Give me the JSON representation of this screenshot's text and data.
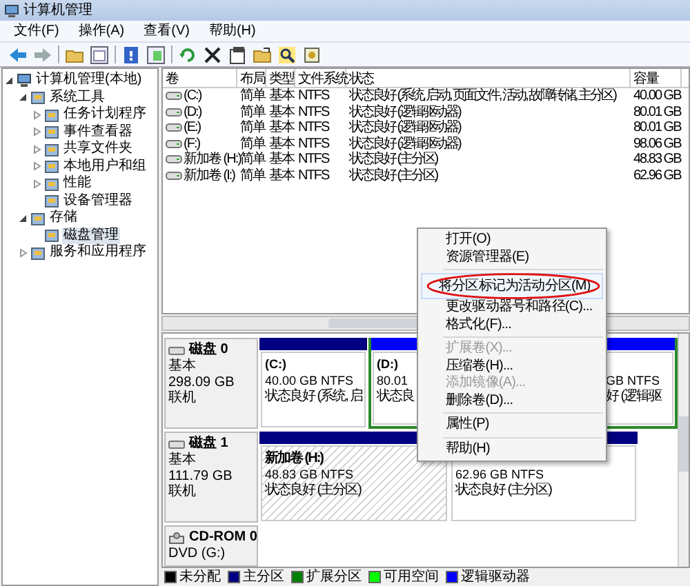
{
  "window": {
    "title": "计算机管理"
  },
  "menu": [
    "文件(F)",
    "操作(A)",
    "查看(V)",
    "帮助(H)"
  ],
  "tree": [
    {
      "label": "计算机管理(本地)",
      "expanded": true,
      "selected": false,
      "children": [
        {
          "label": "系统工具",
          "expanded": true,
          "selected": false,
          "children": [
            {
              "label": "任务计划程序",
              "expanded": false,
              "selected": false
            },
            {
              "label": "事件查看器",
              "expanded": false,
              "selected": false
            },
            {
              "label": "共享文件夹",
              "expanded": false,
              "selected": false
            },
            {
              "label": "本地用户和组",
              "expanded": false,
              "selected": false
            },
            {
              "label": "性能",
              "expanded": false,
              "selected": false
            },
            {
              "label": "设备管理器",
              "selected": false
            }
          ]
        },
        {
          "label": "存储",
          "expanded": true,
          "selected": false,
          "children": [
            {
              "label": "磁盘管理",
              "selected": true
            }
          ]
        },
        {
          "label": "服务和应用程序",
          "expanded": false,
          "selected": false
        }
      ]
    }
  ],
  "volumes": {
    "columns": [
      "卷",
      "布局",
      "类型",
      "文件系统",
      "状态",
      "容量"
    ],
    "rows": [
      [
        "(C:)",
        "简单",
        "基本",
        "NTFS",
        "状态良好 (系统, 启动, 页面文件, 活动, 故障转储, 主分区)",
        "40.00 GB"
      ],
      [
        "(D:)",
        "简单",
        "基本",
        "NTFS",
        "状态良好 (逻辑驱动器)",
        "80.01 GB"
      ],
      [
        "(E:)",
        "简单",
        "基本",
        "NTFS",
        "状态良好 (逻辑驱动器)",
        "80.01 GB"
      ],
      [
        "(F:)",
        "简单",
        "基本",
        "NTFS",
        "状态良好 (逻辑驱动器)",
        "98.06 GB"
      ],
      [
        "新加卷 (H:)",
        "简单",
        "基本",
        "NTFS",
        "状态良好 (主分区)",
        "48.83 GB"
      ],
      [
        "新加卷 (I:)",
        "简单",
        "基本",
        "NTFS",
        "状态良好 (主分区)",
        "62.96 GB"
      ]
    ]
  },
  "disks": [
    {
      "kind": "disk",
      "name": "磁盘 0",
      "type": "基本",
      "size": "298.09 GB",
      "state": "联机",
      "partitions": [
        {
          "kind": "primary",
          "selected": false,
          "title": "(C:)",
          "size": "40.00 GB NTFS",
          "status": "状态良好 (系统, 启"
        },
        {
          "kind": "logical",
          "selected": false,
          "title": "(D:)",
          "size": "80.01",
          "status": "状态良"
        },
        {
          "kind": "logical",
          "selected": false,
          "size": "GB NTFS",
          "status": "好 (逻辑驱"
        }
      ]
    },
    {
      "kind": "disk",
      "name": "磁盘 1",
      "type": "基本",
      "size": "111.79 GB",
      "state": "联机",
      "partitions": [
        {
          "kind": "primary",
          "selected": true,
          "title": "新加卷  (H:)",
          "size": "48.83 GB NTFS",
          "status": "状态良好 (主分区)"
        },
        {
          "kind": "primary",
          "selected": false,
          "size": "62.96 GB NTFS",
          "status": "状态良好 (主分区)"
        }
      ]
    },
    {
      "kind": "cdrom",
      "name": "CD-ROM 0",
      "type": "DVD (G:)"
    }
  ],
  "legend": [
    {
      "label": "未分配",
      "color": "#000000"
    },
    {
      "label": "主分区",
      "color": "#000080"
    },
    {
      "label": "扩展分区",
      "color": "#008000"
    },
    {
      "label": "可用空间",
      "color": "#00ff00"
    },
    {
      "label": "逻辑驱动器",
      "color": "#0000ff"
    }
  ],
  "context_menu": [
    {
      "kind": "item",
      "label": "打开(O)",
      "disabled": false,
      "highlighted": false
    },
    {
      "kind": "item",
      "label": "资源管理器(E)",
      "disabled": false,
      "highlighted": false
    },
    {
      "kind": "separator"
    },
    {
      "kind": "item",
      "label": "将分区标记为活动分区(M)",
      "disabled": false,
      "highlighted": true
    },
    {
      "kind": "item",
      "label": "更改驱动器号和路径(C)...",
      "disabled": false,
      "highlighted": false
    },
    {
      "kind": "item",
      "label": "格式化(F)...",
      "disabled": false,
      "highlighted": false
    },
    {
      "kind": "separator"
    },
    {
      "kind": "item",
      "label": "扩展卷(X)...",
      "disabled": true,
      "highlighted": false
    },
    {
      "kind": "item",
      "label": "压缩卷(H)...",
      "disabled": false,
      "highlighted": false
    },
    {
      "kind": "item",
      "label": "添加镜像(A)...",
      "disabled": true,
      "highlighted": false
    },
    {
      "kind": "item",
      "label": "删除卷(D)...",
      "disabled": false,
      "highlighted": false
    },
    {
      "kind": "separator"
    },
    {
      "kind": "item",
      "label": "属性(P)",
      "disabled": false,
      "highlighted": false
    },
    {
      "kind": "separator"
    },
    {
      "kind": "item",
      "label": "帮助(H)",
      "disabled": false,
      "highlighted": false
    }
  ]
}
